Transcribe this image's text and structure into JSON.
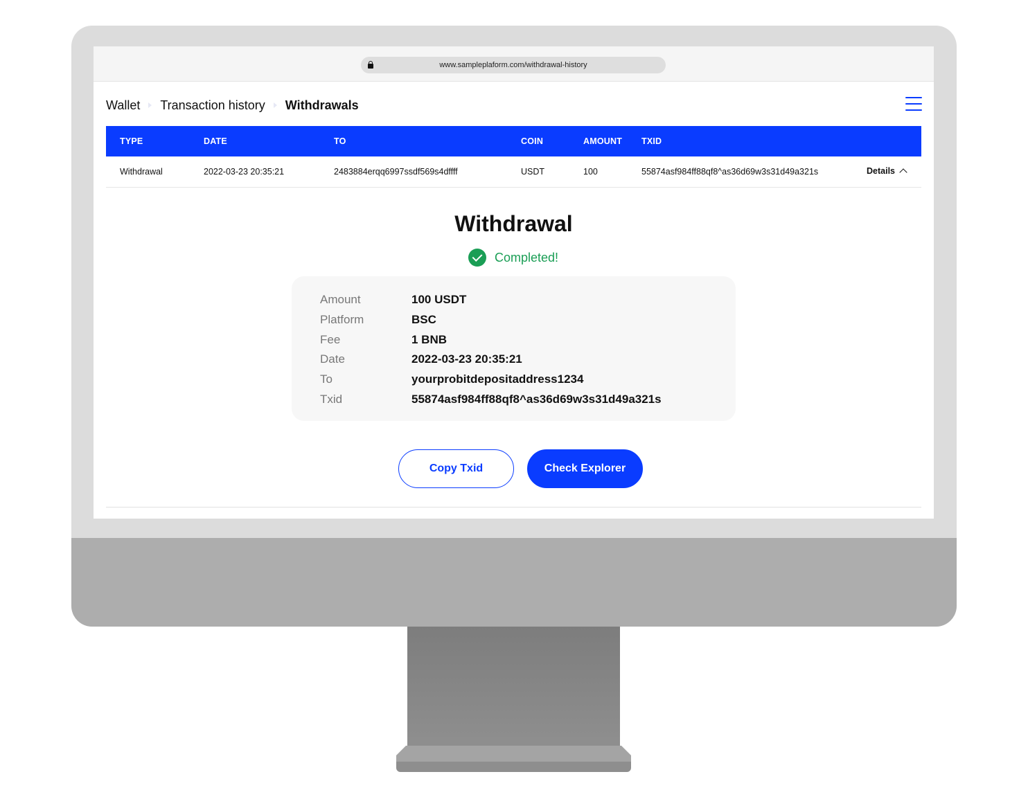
{
  "browser": {
    "url": "www.sampleplaform.com/withdrawal-history"
  },
  "breadcrumb": [
    {
      "label": "Wallet"
    },
    {
      "label": "Transaction history"
    },
    {
      "label": "Withdrawals"
    }
  ],
  "table": {
    "headers": {
      "type": "TYPE",
      "date": "DATE",
      "to": "TO",
      "coin": "COIN",
      "amount": "AMOUNT",
      "txid": "TXID"
    },
    "row": {
      "type": "Withdrawal",
      "date": "2022-03-23 20:35:21",
      "to": "2483884erqq6997ssdf569s4dffff",
      "coin": "USDT",
      "amount": "100",
      "txid": "55874asf984ff88qf8^as36d69w3s31d49a321s",
      "details_label": "Details"
    }
  },
  "detail": {
    "title": "Withdrawal",
    "status": "Completed!",
    "fields": [
      {
        "label": "Amount",
        "value": "100 USDT"
      },
      {
        "label": "Platform",
        "value": "BSC"
      },
      {
        "label": "Fee",
        "value": "1 BNB"
      },
      {
        "label": "Date",
        "value": "2022-03-23 20:35:21"
      },
      {
        "label": "To",
        "value": "yourprobitdepositaddress1234"
      },
      {
        "label": "Txid",
        "value": "55874asf984ff88qf8^as36d69w3s31d49a321s"
      }
    ],
    "copy_button": "Copy Txid",
    "explorer_button": "Check Explorer"
  },
  "colors": {
    "accent": "#0a3cff",
    "success": "#1a9e55"
  }
}
